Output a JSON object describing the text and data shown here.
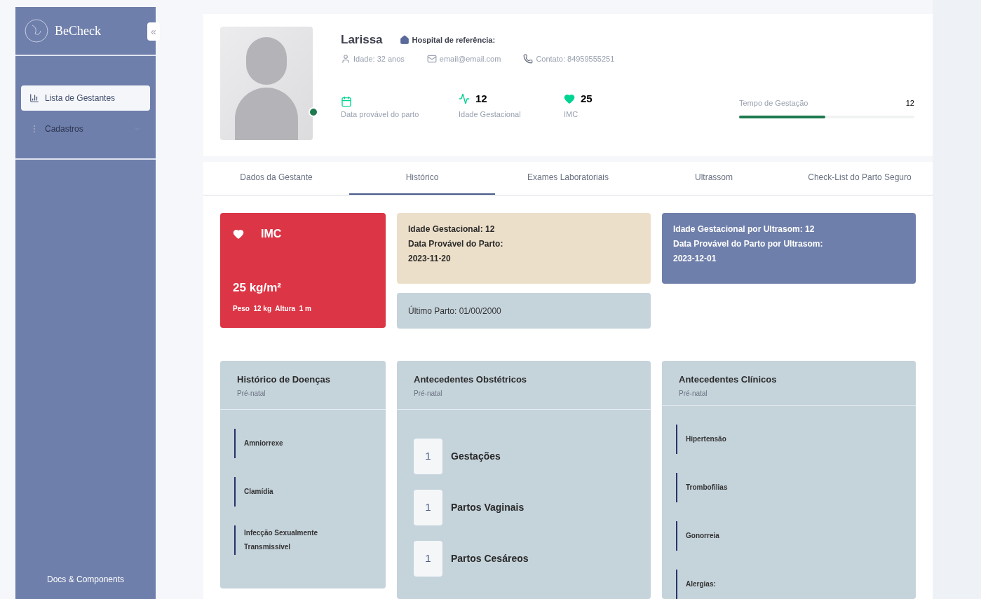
{
  "sidebar": {
    "logo": "BeCheck",
    "collapse_icon": "«",
    "items": [
      {
        "label": "Lista de Gestantes",
        "kind": "chart",
        "selected": true,
        "expandable": false
      },
      {
        "label": "Cadastros",
        "kind": "dots",
        "selected": false,
        "expandable": true
      }
    ],
    "footer": "Docs & Components"
  },
  "profile": {
    "name": "Larissa",
    "hospital": "Hospital de referência:",
    "online": true,
    "contacts": [
      {
        "kind": "user",
        "text": "Idade: 32 anos"
      },
      {
        "kind": "mail",
        "text": "email@email.com"
      },
      {
        "kind": "phone",
        "text": "Contato: 84959555251"
      }
    ],
    "stats": [
      {
        "kind": "calendar",
        "label": "Data provável do parto"
      },
      {
        "kind": "pulse",
        "value": "12",
        "label": "Idade Gestacional"
      },
      {
        "kind": "heart",
        "value": "25",
        "label": "IMC"
      }
    ],
    "progress": {
      "label": "Tempo de Gestação",
      "value": "12",
      "level": 0.49
    }
  },
  "tabs": [
    {
      "label": "Dados da Gestante",
      "selected": false
    },
    {
      "label": "Histórico",
      "selected": true
    },
    {
      "label": "Exames Laboratoriais",
      "selected": false
    },
    {
      "label": "Ultrassom",
      "selected": false
    },
    {
      "label": "Check-List do Parto Seguro",
      "selected": false
    }
  ],
  "imc_card": {
    "title": "IMC",
    "value": "25 kg/m²",
    "details": "Peso  12 kg  Altura  1 m"
  },
  "gestation_card": {
    "lines": [
      "Idade Gestacional: 12",
      "Data Provável do Parto:",
      "2023-11-20"
    ]
  },
  "last_birth_card": {
    "text": "Último Parto: 01/00/2000"
  },
  "ultrasound_card": {
    "lines": [
      "Idade Gestacional por Ultrasom: 12",
      "Data Provável do Parto por Ultrasom:",
      "2023-12-01"
    ]
  },
  "panels": [
    {
      "kind": "list",
      "title": "Histórico de Doenças",
      "subtitle": "Pré-natal",
      "items": [
        "Amniorrexe",
        "Clamídia",
        "Infecção Sexualmente Transmissível"
      ]
    },
    {
      "kind": "counts",
      "title": "Antecedentes Obstétricos",
      "subtitle": "Pré-natal",
      "items": [
        {
          "count": "1",
          "label": "Gestações"
        },
        {
          "count": "1",
          "label": "Partos Vaginais"
        },
        {
          "count": "1",
          "label": "Partos Cesáreos"
        }
      ]
    },
    {
      "kind": "list",
      "title": "Antecedentes Clínicos",
      "subtitle": "Pré-natal",
      "items": [
        "Hipertensão",
        "Trombofilias",
        "Gonorreia",
        "Alergias:"
      ]
    }
  ]
}
